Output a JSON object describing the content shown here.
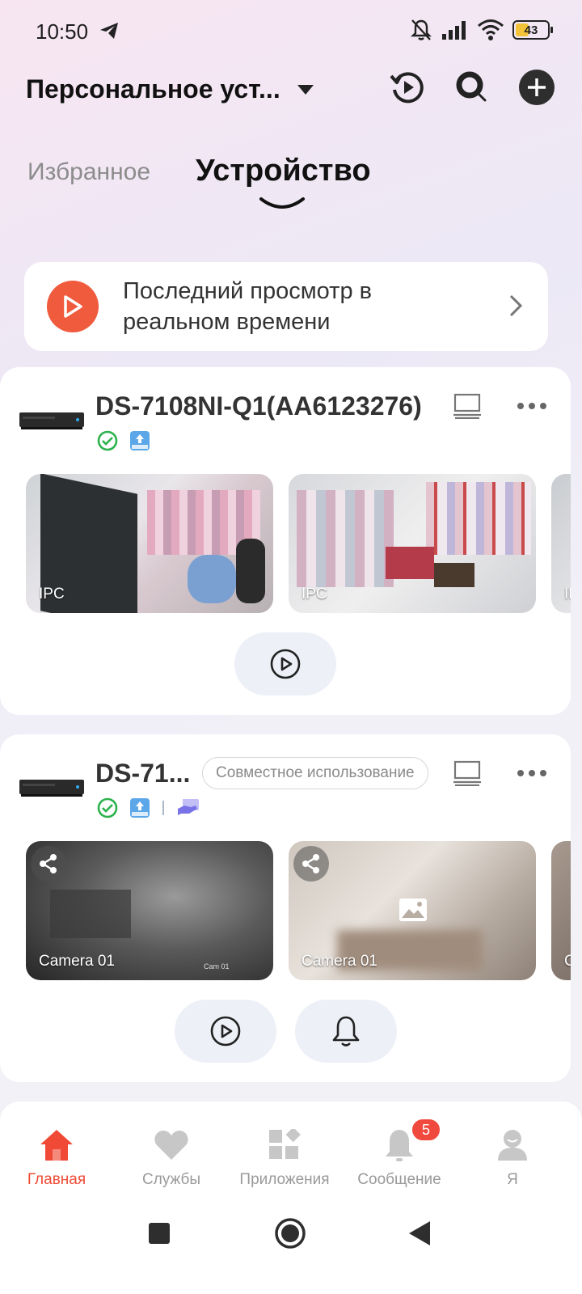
{
  "status_bar": {
    "time": "10:50",
    "battery": "43",
    "battery_level": 0.43
  },
  "header": {
    "device_selector_label": "Персональное уст..."
  },
  "tabs": {
    "favorites": "Избранное",
    "devices": "Устройство"
  },
  "recent": {
    "text": "Последний просмотр в реальном времени"
  },
  "devices": [
    {
      "name": "DS-7108NI-Q1(AA6123276)",
      "cameras": [
        {
          "label": "IPC"
        },
        {
          "label": "IPC"
        },
        {
          "label": "IP"
        }
      ]
    },
    {
      "name": "DS-71...",
      "share_badge": "Совместное использование",
      "cameras": [
        {
          "label": "Camera 01",
          "overlay_text": "Cam 01"
        },
        {
          "label": "Camera 01"
        },
        {
          "label": "C"
        }
      ]
    }
  ],
  "bottom_nav": {
    "items": [
      {
        "label": "Главная",
        "icon": "home-icon",
        "active": true
      },
      {
        "label": "Службы",
        "icon": "heart-icon"
      },
      {
        "label": "Приложения",
        "icon": "apps-icon"
      },
      {
        "label": "Сообщение",
        "icon": "bell-icon",
        "badge": "5"
      },
      {
        "label": "Я",
        "icon": "profile-icon"
      }
    ]
  },
  "colors": {
    "accent": "#f04a36",
    "online": "#2bb24c",
    "storage": "#5ba7e8",
    "share": "#7a73e8"
  }
}
